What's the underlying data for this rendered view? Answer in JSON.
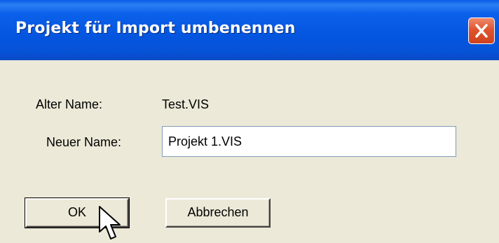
{
  "dialog": {
    "title": "Projekt für Import umbenennen",
    "close_icon": "close-icon",
    "old_name_label": "Alter Name:",
    "old_name_value": "Test.VIS",
    "new_name_label": "Neuer Name:",
    "new_name_value": "Projekt 1.VIS",
    "ok_label": "OK",
    "cancel_label": "Abbrechen"
  },
  "colors": {
    "titlebar": "#0455df",
    "background": "#ece9d8",
    "close_button": "#e0532f"
  },
  "icons": {
    "cursor": "mouse-pointer-icon"
  }
}
